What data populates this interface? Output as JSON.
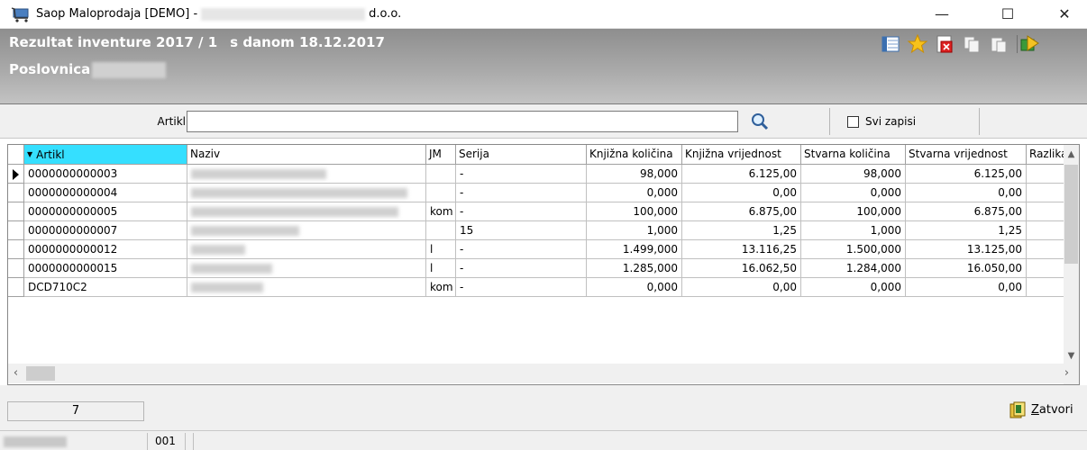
{
  "window": {
    "title_prefix": "Saop Maloprodaja [DEMO] -",
    "title_suffix": "d.o.o.",
    "min_label": "—",
    "max_label": "☐",
    "close_label": "✕"
  },
  "header": {
    "title": "Rezultat inventure 2017 / 1",
    "date_text": "s danom 18.12.2017",
    "branch_label": "Poslovnica",
    "toolbar_icons": [
      "columns-icon",
      "star-icon",
      "delete-icon",
      "copy-icon",
      "paste-icon",
      "exit-icon"
    ]
  },
  "filter": {
    "label": "Artikl",
    "value": "",
    "show_all_label": "Svi zapisi",
    "show_all_checked": false
  },
  "grid": {
    "columns": [
      {
        "label": "Artikl",
        "sorted": true
      },
      {
        "label": "Naziv"
      },
      {
        "label": "JM"
      },
      {
        "label": "Serija"
      },
      {
        "label": "Knjižna količina"
      },
      {
        "label": "Knjižna vrijednost"
      },
      {
        "label": "Stvarna količina"
      },
      {
        "label": "Stvarna vrijednost"
      },
      {
        "label": "Razlika"
      }
    ],
    "rows": [
      {
        "artikl": "0000000000003",
        "jm": "",
        "serija": "-",
        "knj_kol": "98,000",
        "knj_vr": "6.125,00",
        "stv_kol": "98,000",
        "stv_vr": "6.125,00",
        "current": true
      },
      {
        "artikl": "0000000000004",
        "jm": "",
        "serija": "-",
        "knj_kol": "0,000",
        "knj_vr": "0,00",
        "stv_kol": "0,000",
        "stv_vr": "0,00"
      },
      {
        "artikl": "0000000000005",
        "jm": "kom",
        "serija": "-",
        "knj_kol": "100,000",
        "knj_vr": "6.875,00",
        "stv_kol": "100,000",
        "stv_vr": "6.875,00"
      },
      {
        "artikl": "0000000000007",
        "jm": "",
        "serija": "15",
        "knj_kol": "1,000",
        "knj_vr": "1,25",
        "stv_kol": "1,000",
        "stv_vr": "1,25"
      },
      {
        "artikl": "0000000000012",
        "jm": "l",
        "serija": "-",
        "knj_kol": "1.499,000",
        "knj_vr": "13.116,25",
        "stv_kol": "1.500,000",
        "stv_vr": "13.125,00"
      },
      {
        "artikl": "0000000000015",
        "jm": "l",
        "serija": "-",
        "knj_kol": "1.285,000",
        "knj_vr": "16.062,50",
        "stv_kol": "1.284,000",
        "stv_vr": "16.050,00"
      },
      {
        "artikl": "DCD710C2",
        "jm": "kom",
        "serija": "-",
        "knj_kol": "0,000",
        "knj_vr": "0,00",
        "stv_kol": "0,000",
        "stv_vr": "0,00"
      }
    ]
  },
  "footer": {
    "record_count": "7",
    "close_label_first": "Z",
    "close_label_rest": "atvori",
    "status_code": "001"
  }
}
